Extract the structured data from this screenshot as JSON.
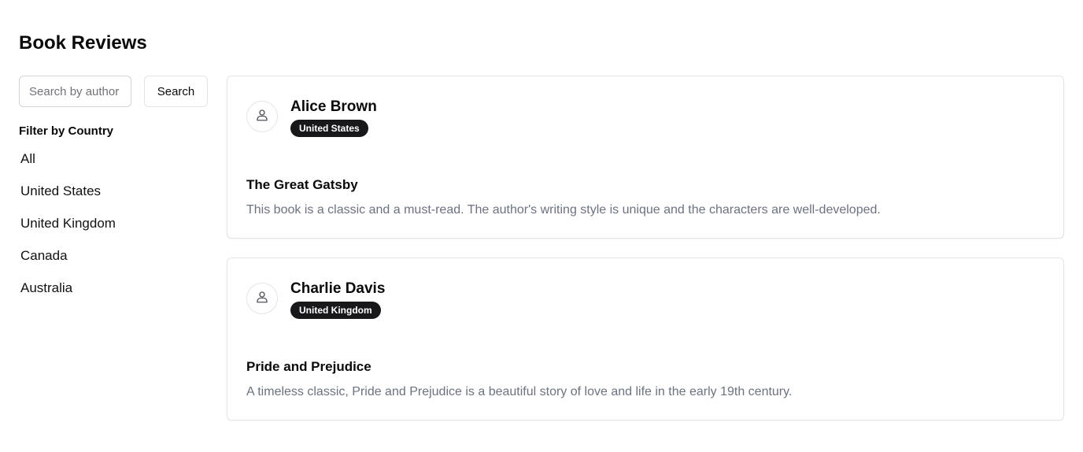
{
  "page": {
    "title": "Book Reviews"
  },
  "search": {
    "placeholder": "Search by author",
    "button_label": "Search"
  },
  "filter": {
    "heading": "Filter by Country",
    "options": [
      "All",
      "United States",
      "United Kingdom",
      "Canada",
      "Australia"
    ]
  },
  "reviews": [
    {
      "reviewer": "Alice Brown",
      "country": "United States",
      "book_title": "The Great Gatsby",
      "text": "This book is a classic and a must-read. The author's writing style is unique and the characters are well-developed.",
      "avatar_icon": "user-icon"
    },
    {
      "reviewer": "Charlie Davis",
      "country": "United Kingdom",
      "book_title": "Pride and Prejudice",
      "text": "A timeless classic, Pride and Prejudice is a beautiful story of love and life in the early 19th century.",
      "avatar_icon": "user-icon"
    }
  ],
  "colors": {
    "badge_background": "#18181b",
    "badge_text": "#ffffff",
    "muted_text": "#6b7280",
    "border": "#e4e4e7"
  }
}
